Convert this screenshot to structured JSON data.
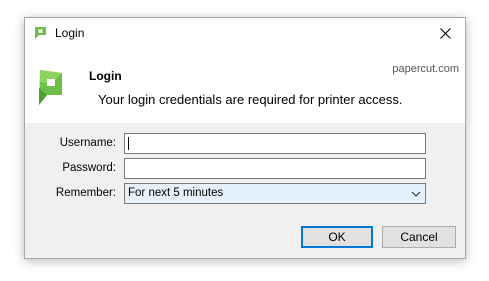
{
  "window": {
    "title": "Login",
    "close_glyph": "✕"
  },
  "banner": {
    "heading": "Login",
    "site": "papercut.com",
    "message": "Your login credentials are required for printer access."
  },
  "form": {
    "username_label": "Username:",
    "username_value": "",
    "password_label": "Password:",
    "password_value": "",
    "remember_label": "Remember:",
    "remember_selected": "For next 5 minutes"
  },
  "buttons": {
    "ok": "OK",
    "cancel": "Cancel"
  },
  "icons": {
    "app": "papercut-logo-icon",
    "close": "close-icon",
    "dropdown": "chevron-down-icon"
  },
  "colors": {
    "brand_green": "#6cc04a",
    "focus_blue": "#0078d7"
  }
}
